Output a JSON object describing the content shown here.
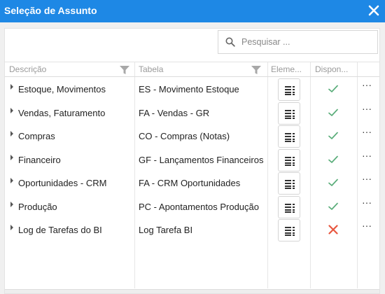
{
  "dialog": {
    "title": "Seleção de Assunto",
    "accent_color": "#1e88e5"
  },
  "search": {
    "placeholder": "Pesquisar ..."
  },
  "columns": {
    "descricao": "Descrição",
    "tabela": "Tabela",
    "elementos": "Eleme...",
    "disponivel": "Dispon..."
  },
  "rows": [
    {
      "descricao": "Estoque, Movimentos",
      "tabela": "ES - Movimento Estoque",
      "disponivel": true
    },
    {
      "descricao": "Vendas, Faturamento",
      "tabela": "FA - Vendas - GR",
      "disponivel": true
    },
    {
      "descricao": "Compras",
      "tabela": "CO - Compras (Notas)",
      "disponivel": true
    },
    {
      "descricao": "Financeiro",
      "tabela": "GF - Lançamentos Financeiros",
      "disponivel": true
    },
    {
      "descricao": "Oportunidades - CRM",
      "tabela": "FA - CRM Oportunidades",
      "disponivel": true
    },
    {
      "descricao": "Produção",
      "tabela": "PC - Apontamentos Produção",
      "disponivel": true
    },
    {
      "descricao": "Log de Tarefas do BI",
      "tabela": "Log Tarefa BI",
      "disponivel": false
    }
  ],
  "icons": {
    "close": "close-icon",
    "search": "search-icon",
    "filter": "filter-icon",
    "elements": "list-icon",
    "available": "check-icon",
    "unavailable": "x-icon",
    "more": "more-icon"
  },
  "more_label": "···",
  "colors": {
    "check": "#5aad7a",
    "cross": "#e8573f"
  }
}
